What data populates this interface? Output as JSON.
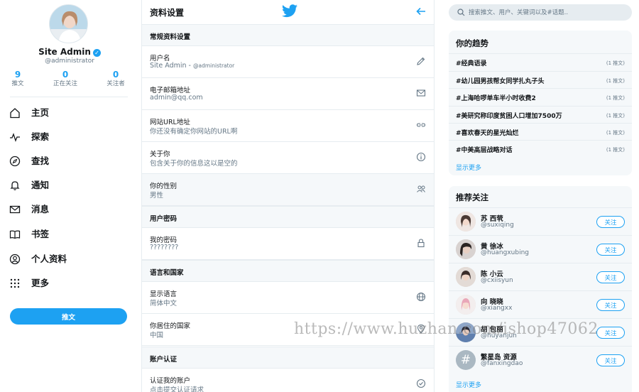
{
  "profile": {
    "name": "Site Admin",
    "handle": "@administrator",
    "stats": [
      {
        "num": "9",
        "label": "推文"
      },
      {
        "num": "0",
        "label": "正在关注"
      },
      {
        "num": "0",
        "label": "关注者"
      }
    ]
  },
  "nav": [
    {
      "label": "主页",
      "icon": "home-icon"
    },
    {
      "label": "探索",
      "icon": "explore-icon"
    },
    {
      "label": "查找",
      "icon": "compass-icon"
    },
    {
      "label": "通知",
      "icon": "bell-icon"
    },
    {
      "label": "消息",
      "icon": "mail-icon"
    },
    {
      "label": "书签",
      "icon": "book-icon"
    },
    {
      "label": "个人资料",
      "icon": "user-icon"
    },
    {
      "label": "更多",
      "icon": "more-grid-icon"
    }
  ],
  "tweet_button": "推文",
  "settings": {
    "title": "资料设置",
    "sections": [
      {
        "title": "常规资料设置"
      },
      {
        "title": "用户密码"
      },
      {
        "title": "语言和国家"
      },
      {
        "title": "账户认证"
      }
    ],
    "rows": [
      {
        "label": "用户名",
        "value": "Site Admin - ",
        "value_sub": "@administrator",
        "icon": "pencil-icon"
      },
      {
        "label": "电子邮箱地址",
        "value": "admin@qq.com",
        "icon": "envelope-icon"
      },
      {
        "label": "网站URL地址",
        "value": "你还没有确定你网站的URL啊",
        "icon": "link-icon"
      },
      {
        "label": "关于你",
        "value": "包含关于你的信息这以是空的",
        "icon": "info-icon"
      },
      {
        "label": "你的性别",
        "value": "男性",
        "icon": "people-icon"
      },
      {
        "label": "我的密码",
        "value": "????????",
        "icon": "lock-icon"
      },
      {
        "label": "显示语言",
        "value": "简体中文",
        "icon": "globe-icon"
      },
      {
        "label": "你居住的国家",
        "value": "中国",
        "icon": "location-icon"
      },
      {
        "label": "认证我的账户",
        "value": "点击提交认证请求",
        "icon": "check-circle-icon"
      }
    ]
  },
  "search": {
    "placeholder": "搜索推文、用户、关键词以及#话题.."
  },
  "trends": {
    "title": "你的趋势",
    "items": [
      {
        "tag": "#经典语录",
        "count": "(1 推文)"
      },
      {
        "tag": "#幼儿园男孩帮女同学扎丸子头",
        "count": "(1 推文)"
      },
      {
        "tag": "#上海哈啰单车半小时收费2",
        "count": "(1 推文)"
      },
      {
        "tag": "#美研究称印度贫困人口增加7500万",
        "count": "(1 推文)"
      },
      {
        "tag": "#喜欢春天的星光灿烂",
        "count": "(1 推文)"
      },
      {
        "tag": "#中美高层战略对话",
        "count": "(1 推文)"
      }
    ],
    "more": "显示更多"
  },
  "follow": {
    "title": "推荐关注",
    "items": [
      {
        "name": "苏 西茕",
        "handle": "@suxiqing"
      },
      {
        "name": "黄 徐冰",
        "handle": "@huangxubing"
      },
      {
        "name": "陈 小云",
        "handle": "@cxiisyun"
      },
      {
        "name": "向 晓晓",
        "handle": "@xiangxx"
      },
      {
        "name": "胡 包丽",
        "handle": "@huyanjun"
      },
      {
        "name": "繁星岛 资源",
        "handle": "@fanxingdao"
      }
    ],
    "button": "关注",
    "more": "显示更多"
  },
  "watermark": "https://www.huzhan.com/ishop47062",
  "colors": {
    "accent": "#1da1f2",
    "muted": "#657786",
    "panel": "#f5f8fa"
  }
}
